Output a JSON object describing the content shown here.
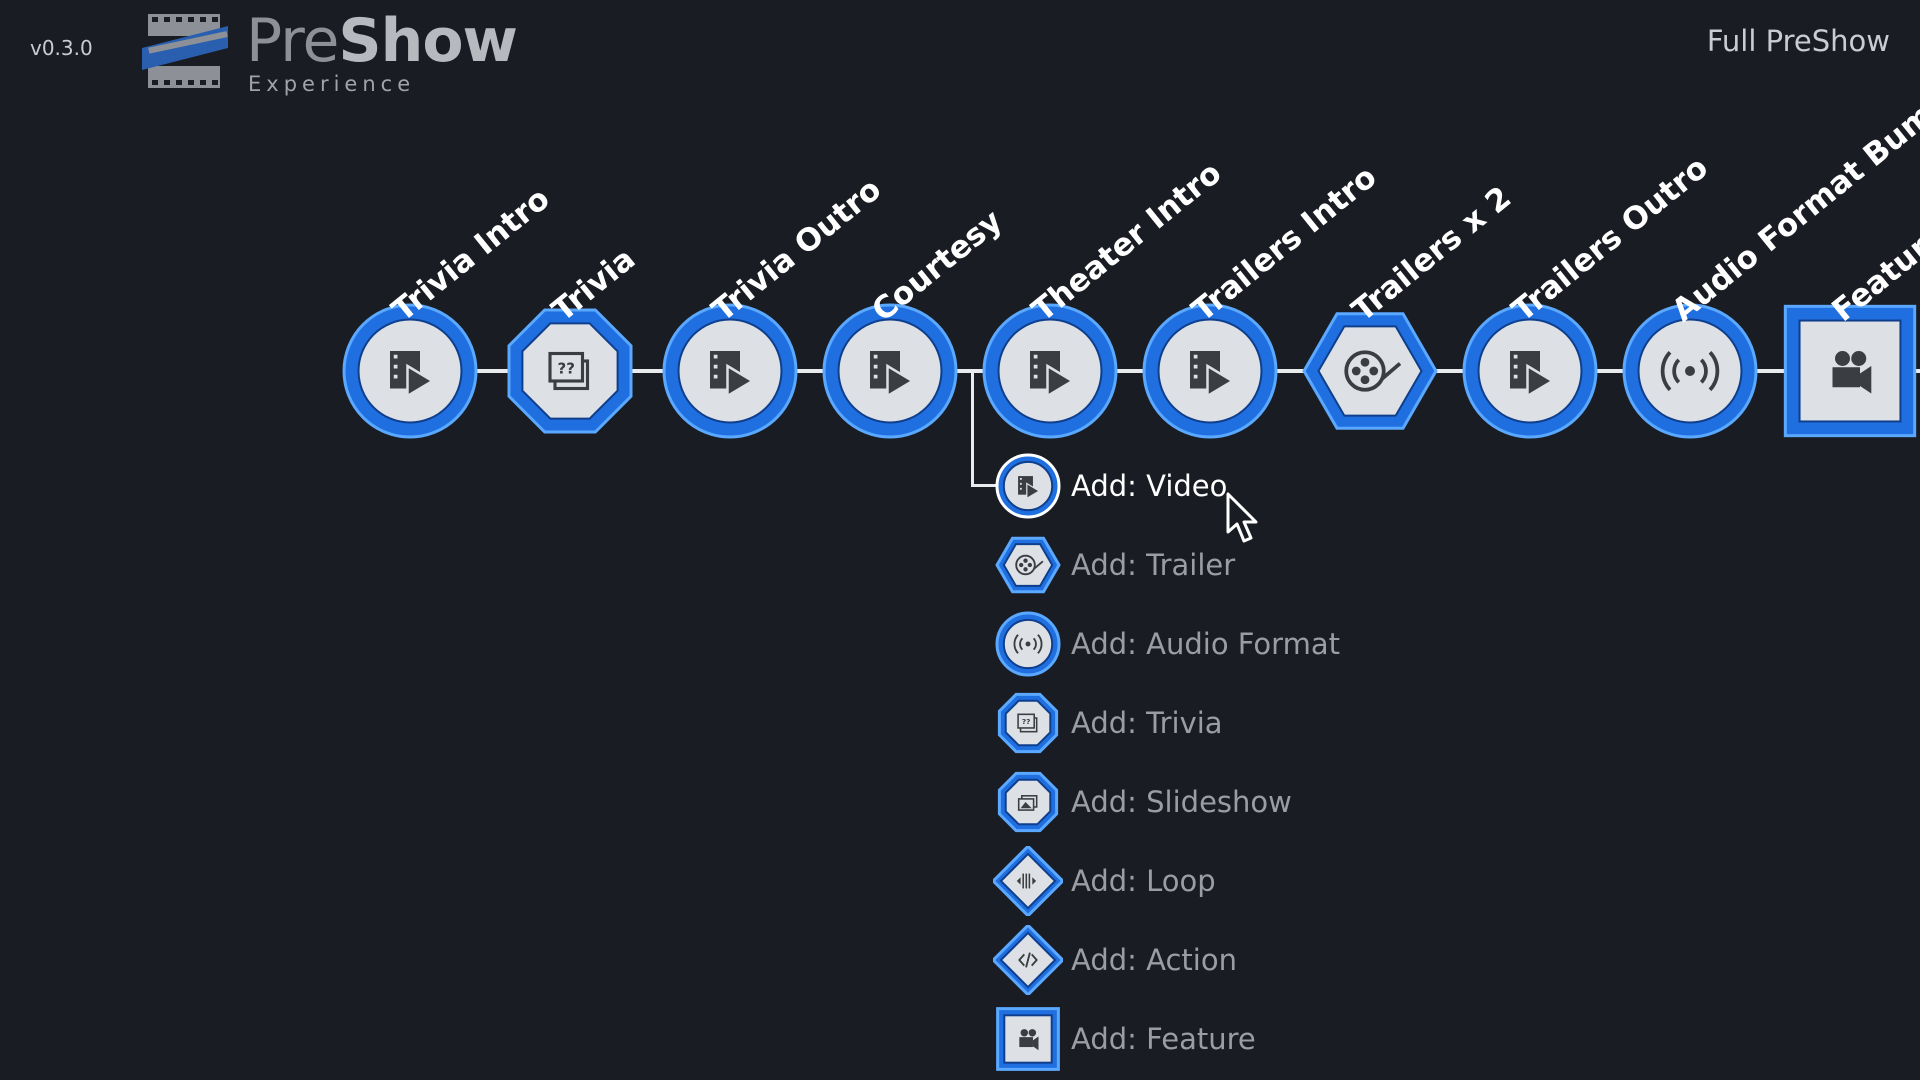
{
  "app": {
    "version": "v0.3.0",
    "logo_word_light": "Pre",
    "logo_word_bold": "Show",
    "logo_sub": "Experience",
    "sequence_title": "Full PreShow"
  },
  "colors": {
    "background": "#191c22",
    "accent_blue": "#1f6fe0",
    "accent_light": "#5aa8ff",
    "icon_face": "#dde0e4",
    "icon_glyph": "#3a3d42",
    "line": "#e9ebee"
  },
  "timeline": {
    "items": [
      {
        "label": "Trivia Intro",
        "shape": "circle",
        "icon": "video-icon"
      },
      {
        "label": "Trivia",
        "shape": "octagon",
        "icon": "trivia-icon"
      },
      {
        "label": "Trivia Outro",
        "shape": "circle",
        "icon": "video-icon"
      },
      {
        "label": "Courtesy",
        "shape": "circle",
        "icon": "video-icon"
      },
      {
        "label": "Theater Intro",
        "shape": "circle",
        "icon": "video-icon"
      },
      {
        "label": "Trailers Intro",
        "shape": "circle",
        "icon": "video-icon"
      },
      {
        "label": "Trailers x 2",
        "shape": "hexagon",
        "icon": "film-reel-icon"
      },
      {
        "label": "Trailers Outro",
        "shape": "circle",
        "icon": "video-icon"
      },
      {
        "label": "Audio Format Bumper",
        "shape": "circle",
        "icon": "audio-format-icon"
      },
      {
        "label": "Feature",
        "shape": "square",
        "icon": "movie-camera-icon"
      }
    ]
  },
  "add_menu": {
    "items": [
      {
        "label": "Add: Video",
        "shape": "circle",
        "icon": "video-icon",
        "selected": true
      },
      {
        "label": "Add: Trailer",
        "shape": "hexagon",
        "icon": "film-reel-icon",
        "selected": false
      },
      {
        "label": "Add: Audio Format",
        "shape": "circle",
        "icon": "audio-format-icon",
        "selected": false
      },
      {
        "label": "Add: Trivia",
        "shape": "octagon",
        "icon": "trivia-icon",
        "selected": false
      },
      {
        "label": "Add: Slideshow",
        "shape": "octagon",
        "icon": "slideshow-icon",
        "selected": false
      },
      {
        "label": "Add: Loop",
        "shape": "diamond",
        "icon": "loop-icon",
        "selected": false
      },
      {
        "label": "Add: Action",
        "shape": "diamond",
        "icon": "action-code-icon",
        "selected": false
      },
      {
        "label": "Add: Feature",
        "shape": "square",
        "icon": "movie-camera-icon",
        "selected": false
      }
    ]
  }
}
